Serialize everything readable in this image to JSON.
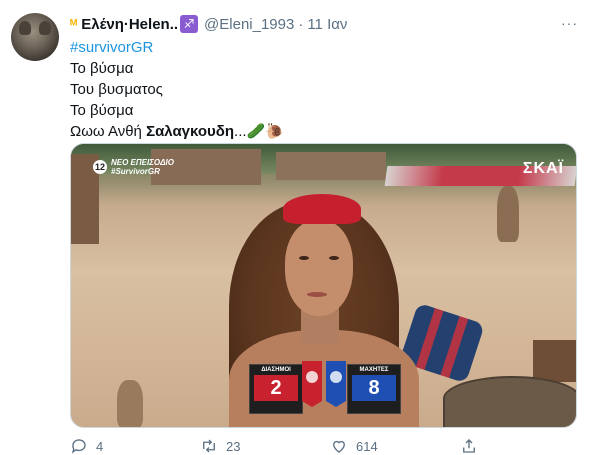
{
  "tweet": {
    "display_name": "Ελένη·Helen..",
    "handle": "@Eleni_1993",
    "separator": "·",
    "date": "11 Ιαν",
    "more": "···",
    "hashtag": "#survivorGR",
    "lines": [
      "Το βύσμα",
      "Του βυσματος",
      "Το βύσμα"
    ],
    "last_line_prefix": "Ωωω Ανθή ",
    "last_line_bold": "Σαλαγκουδη",
    "last_line_suffix": "...🥒🐌"
  },
  "media": {
    "channel_logo": "12",
    "overlay_line1": "ΝΕΟ ΕΠΕΙΣΟΔΙΟ",
    "overlay_line2": "#SurvivorGR",
    "broadcaster": "ΣΚΑΪ",
    "score": {
      "left_team": "ΔΙΑΣΗΜΟΙ",
      "left_score": "2",
      "right_team": "ΜΑΧΗΤΕΣ",
      "right_score": "8",
      "left_color": "#c8222f",
      "right_color": "#1f4fb3"
    }
  },
  "actions": {
    "reply_count": "4",
    "retweet_count": "23",
    "like_count": "614"
  },
  "icons": [
    "crown-icon",
    "sagittarius-icon",
    "more-icon",
    "reply-icon",
    "retweet-icon",
    "like-icon",
    "share-icon"
  ],
  "colors": {
    "link": "#1b95e0",
    "muted": "#5b7083",
    "text": "#0f1419"
  }
}
